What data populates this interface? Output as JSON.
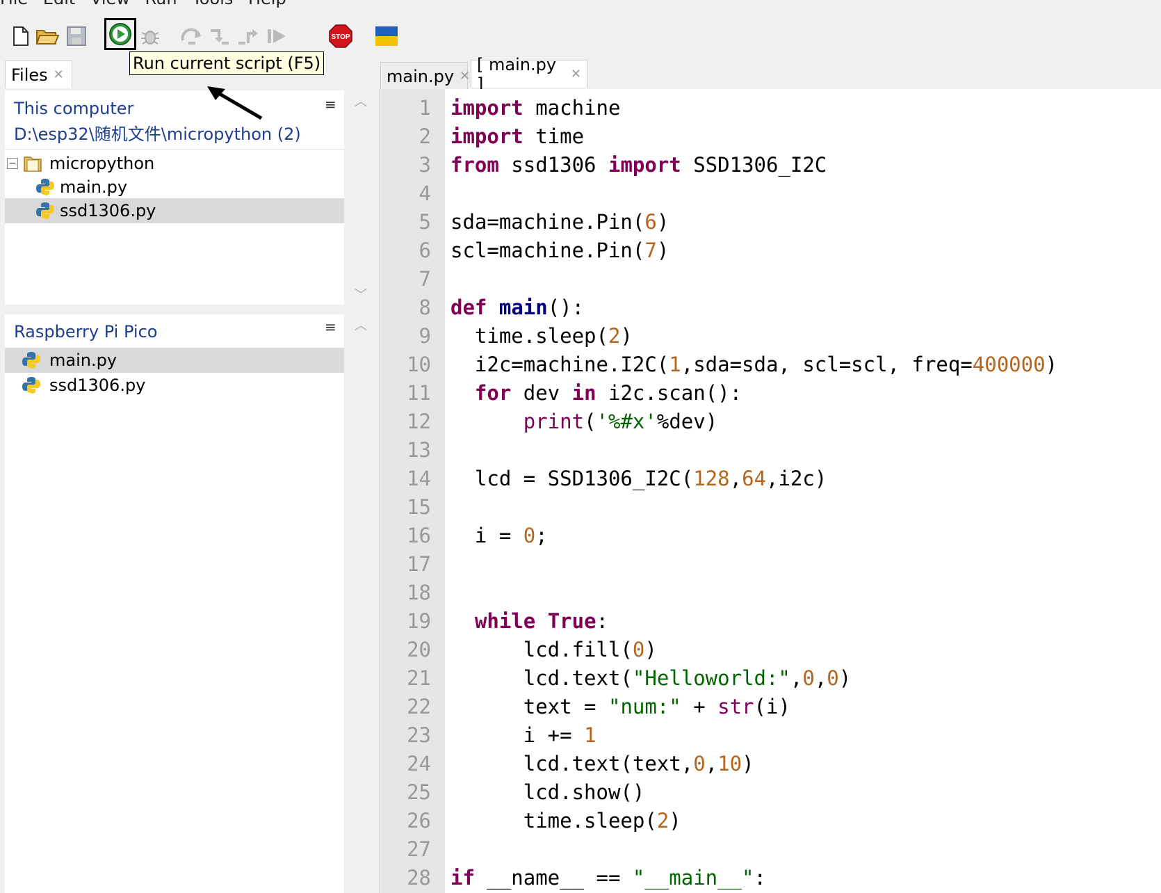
{
  "menu": [
    "File",
    "Edit",
    "View",
    "Run",
    "Tools",
    "Help"
  ],
  "toolbar": {
    "tooltip": "Run current script (F5)",
    "stop_label": "STOP"
  },
  "files_tab": {
    "label": "Files"
  },
  "local": {
    "title": "This computer",
    "path": "D:\\esp32\\随机文件\\micropython (2)",
    "folder": "micropython",
    "files": [
      "main.py",
      "ssd1306.py"
    ]
  },
  "device": {
    "title": "Raspberry Pi Pico",
    "files": [
      "main.py",
      "ssd1306.py"
    ]
  },
  "editor_tabs": [
    "main.py",
    "[ main.py ]"
  ],
  "line_numbers": [
    "1",
    "2",
    "3",
    "4",
    "5",
    "6",
    "7",
    "8",
    "9",
    "10",
    "11",
    "12",
    "13",
    "14",
    "15",
    "16",
    "17",
    "18",
    "19",
    "20",
    "21",
    "22",
    "23",
    "24",
    "25",
    "26",
    "27",
    "28"
  ],
  "code": {
    "l1": [
      "import",
      " machine"
    ],
    "l2": [
      "import",
      " time"
    ],
    "l3": [
      "from",
      " ssd1306 ",
      "import",
      " SSD1306_I2C"
    ],
    "l5": [
      "sda=machine.Pin(",
      "6",
      ")"
    ],
    "l6": [
      "scl=machine.Pin(",
      "7",
      ")"
    ],
    "l8": [
      "def",
      " ",
      "main",
      "():"
    ],
    "l9": [
      "  time.sleep(",
      "2",
      ")"
    ],
    "l10": [
      "  i2c=machine.I2C(",
      "1",
      ",sda=sda, scl=scl, freq=",
      "400000",
      ")"
    ],
    "l11": [
      "  ",
      "for",
      " dev ",
      "in",
      " i2c.scan():"
    ],
    "l12": [
      "      ",
      "print",
      "(",
      "'%#x'",
      "%dev)"
    ],
    "l14": [
      "  lcd = SSD1306_I2C(",
      "128",
      ",",
      "64",
      ",i2c)"
    ],
    "l16": [
      "  i = ",
      "0",
      ";"
    ],
    "l19": [
      "  ",
      "while",
      " ",
      "True",
      ":"
    ],
    "l20": [
      "      lcd.fill(",
      "0",
      ")"
    ],
    "l21": [
      "      lcd.text(",
      "\"Helloworld:\"",
      ",",
      "0",
      ",",
      "0",
      ")"
    ],
    "l22": [
      "      text = ",
      "\"num:\"",
      " + ",
      "str",
      "(i)"
    ],
    "l23": [
      "      i += ",
      "1"
    ],
    "l24": [
      "      lcd.text(text,",
      "0",
      ",",
      "10",
      ")"
    ],
    "l25": [
      "      lcd.show()"
    ],
    "l26": [
      "      time.sleep(",
      "2",
      ")"
    ],
    "l28": [
      "if",
      " __name__ == ",
      "\"__main__\"",
      ":"
    ]
  }
}
